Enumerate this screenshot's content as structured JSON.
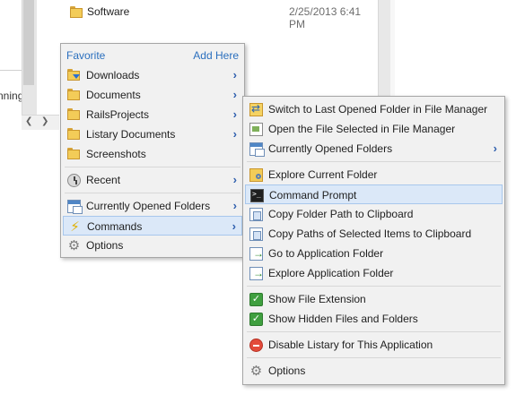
{
  "background_window": {
    "row": {
      "name": "Software",
      "date": "2/25/2013 6:41 PM"
    },
    "cut_text": "nning"
  },
  "menu_main": {
    "header_left": "Favorite",
    "header_right": "Add Here",
    "favorites": [
      {
        "label": "Downloads",
        "icon": "downloads-folder-icon",
        "has_submenu": true
      },
      {
        "label": "Documents",
        "icon": "folder-icon",
        "has_submenu": true
      },
      {
        "label": "RailsProjects",
        "icon": "folder-icon",
        "has_submenu": true
      },
      {
        "label": "Listary Documents",
        "icon": "folder-icon",
        "has_submenu": true
      },
      {
        "label": "Screenshots",
        "icon": "folder-icon",
        "has_submenu": false
      }
    ],
    "recent_label": "Recent",
    "current_folders_label": "Currently Opened Folders",
    "commands_label": "Commands",
    "options_label": "Options"
  },
  "menu_commands": {
    "items": {
      "switch": "Switch to Last Opened Folder in File Manager",
      "open_selected": "Open the File Selected in File Manager",
      "current_folders": "Currently Opened Folders",
      "explore_current": "Explore Current Folder",
      "command_prompt": "Command Prompt",
      "copy_folder_path": "Copy Folder Path to Clipboard",
      "copy_paths_selected": "Copy Paths of Selected Items to Clipboard",
      "go_to_app_folder": "Go to Application Folder",
      "explore_app_folder": "Explore Application Folder",
      "show_file_extension": "Show File Extension",
      "show_hidden": "Show Hidden Files and Folders",
      "disable_listary": "Disable Listary for This Application",
      "options": "Options"
    }
  },
  "glyphs": {
    "chevron": "›",
    "check": "✓",
    "gear": "⚙",
    "bolt": "⚡",
    "scroll_left": "❮",
    "scroll_right": "❯"
  },
  "colors": {
    "accent_link": "#2a6fbe",
    "highlight_bg": "#dbe8f8",
    "highlight_border": "#a8c7ec",
    "menu_bg": "#f1f1f1"
  }
}
